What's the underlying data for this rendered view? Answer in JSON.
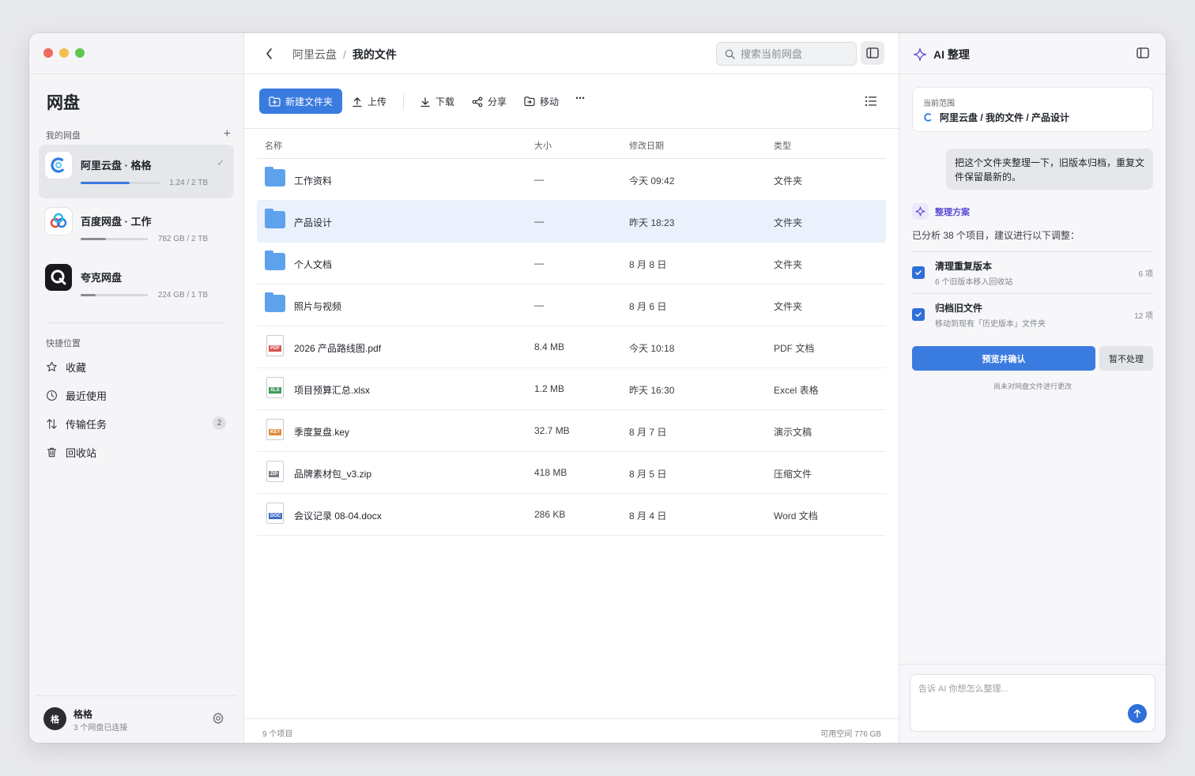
{
  "sidebar": {
    "title": "网盘",
    "my_drives_label": "我的网盘",
    "add_label": "+",
    "drives": [
      {
        "name": "阿里云盘 · 格格",
        "quota": "1.24 / 2 TB",
        "usage": 0.62,
        "color": "#3a7be0",
        "active": true
      },
      {
        "name": "百度网盘 · 工作",
        "quota": "782 GB / 2 TB",
        "usage": 0.38,
        "color": "#8a8d93",
        "active": false
      },
      {
        "name": "夸克网盘",
        "quota": "224 GB / 1 TB",
        "usage": 0.22,
        "color": "#8a8d93",
        "active": false
      }
    ],
    "quick_label": "快捷位置",
    "quick_items": [
      {
        "label": "收藏",
        "icon": "star-icon"
      },
      {
        "label": "最近使用",
        "icon": "clock-icon"
      },
      {
        "label": "传输任务",
        "icon": "transfer-icon",
        "badge": "2"
      },
      {
        "label": "回收站",
        "icon": "trash-icon"
      }
    ],
    "user": {
      "avatar": "格",
      "name": "格格",
      "subtitle": "3 个网盘已连接"
    }
  },
  "main": {
    "breadcrumb": [
      "阿里云盘",
      "我的文件"
    ],
    "breadcrumb_sep": "/",
    "search_placeholder": "搜索当前网盘",
    "toolbar": {
      "new_folder": "新建文件夹",
      "upload": "上传",
      "download": "下载",
      "share": "分享",
      "move": "移动",
      "more": "···"
    },
    "columns": {
      "name": "名称",
      "size": "大小",
      "date": "修改日期",
      "type": "类型"
    },
    "files": [
      {
        "name": "工作资料",
        "size": "—",
        "date": "今天 09:42",
        "type": "文件夹",
        "kind": "folder"
      },
      {
        "name": "产品设计",
        "size": "—",
        "date": "昨天 18:23",
        "type": "文件夹",
        "kind": "folder",
        "selected": true
      },
      {
        "name": "个人文档",
        "size": "—",
        "date": "8 月 8 日",
        "type": "文件夹",
        "kind": "folder"
      },
      {
        "name": "照片与视频",
        "size": "—",
        "date": "8 月 6 日",
        "type": "文件夹",
        "kind": "folder"
      },
      {
        "name": "2026 产品路线图.pdf",
        "size": "8.4 MB",
        "date": "今天 10:18",
        "type": "PDF 文档",
        "kind": "file",
        "badge": "PDF",
        "badge_color": "#d9534f"
      },
      {
        "name": "项目预算汇总.xlsx",
        "size": "1.2 MB",
        "date": "昨天 16:30",
        "type": "Excel 表格",
        "kind": "file",
        "badge": "XLS",
        "badge_color": "#3f9a5a"
      },
      {
        "name": "季度复盘.key",
        "size": "32.7 MB",
        "date": "8 月 7 日",
        "type": "演示文稿",
        "kind": "file",
        "badge": "KEY",
        "badge_color": "#e08a3a"
      },
      {
        "name": "品牌素材包_v3.zip",
        "size": "418 MB",
        "date": "8 月 5 日",
        "type": "压缩文件",
        "kind": "file",
        "badge": "ZIP",
        "badge_color": "#7b7f86"
      },
      {
        "name": "会议记录 08-04.docx",
        "size": "286 KB",
        "date": "8 月 4 日",
        "type": "Word 文档",
        "kind": "file",
        "badge": "DOC",
        "badge_color": "#3f6fc7"
      }
    ],
    "status_left": "9 个项目",
    "status_right": "可用空间 776 GB"
  },
  "ai": {
    "title": "AI 整理",
    "scope_label": "当前范围",
    "scope_path": "阿里云盘 / 我的文件 / 产品设计",
    "user_message": "把这个文件夹整理一下，旧版本归档，重复文件保留最新的。",
    "plan_title": "整理方案",
    "plan_desc": "已分析 38 个项目，建议进行以下调整：",
    "plan_items": [
      {
        "title": "清理重复版本",
        "subtitle": "6 个旧版本移入回收站",
        "count": "6 项",
        "checked": true
      },
      {
        "title": "归档旧文件",
        "subtitle": "移动到现有「历史版本」文件夹",
        "count": "12 项",
        "checked": true
      }
    ],
    "confirm_label": "预览并确认",
    "skip_label": "暂不处理",
    "note": "尚未对网盘文件进行更改",
    "composer_placeholder": "告诉 AI 你想怎么整理..."
  },
  "colors": {
    "accent": "#3a7be0",
    "ai_purple": "#5b4bd6",
    "folder": "#5ea2ee"
  }
}
